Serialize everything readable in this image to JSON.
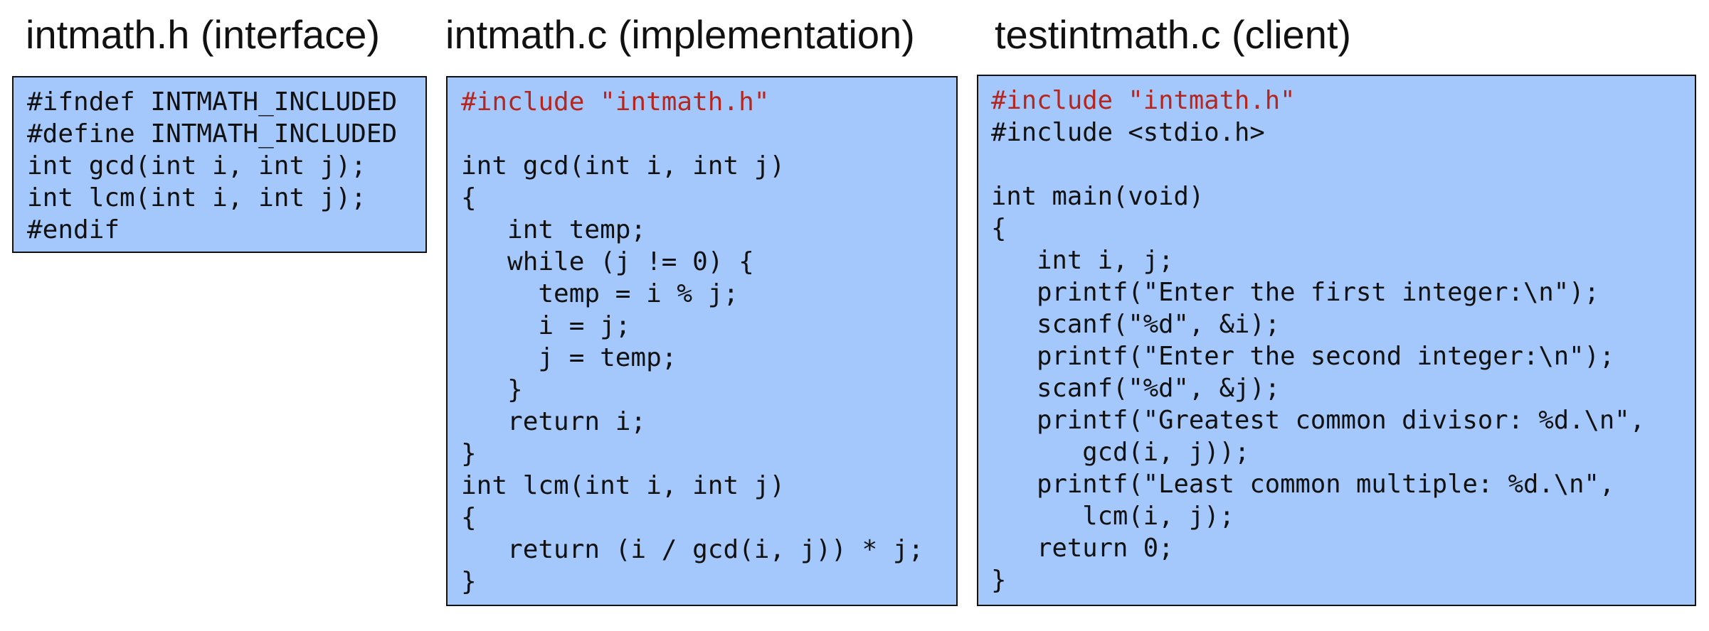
{
  "panels": {
    "header": {
      "title": "intmath.h (interface)",
      "lines": [
        {
          "text": "#ifndef INTMATH_INCLUDED",
          "kind": "code"
        },
        {
          "text": "#define INTMATH_INCLUDED",
          "kind": "code"
        },
        {
          "text": "int gcd(int i, int j);",
          "kind": "code"
        },
        {
          "text": "int lcm(int i, int j);",
          "kind": "code"
        },
        {
          "text": "#endif",
          "kind": "code"
        }
      ]
    },
    "impl": {
      "title": "intmath.c (implementation)",
      "lines": [
        {
          "text": "#include \"intmath.h\"",
          "kind": "include"
        },
        {
          "text": "",
          "kind": "code"
        },
        {
          "text": "int gcd(int i, int j)",
          "kind": "code"
        },
        {
          "text": "{",
          "kind": "code"
        },
        {
          "text": "   int temp;",
          "kind": "code"
        },
        {
          "text": "   while (j != 0) {",
          "kind": "code"
        },
        {
          "text": "     temp = i % j;",
          "kind": "code"
        },
        {
          "text": "     i = j;",
          "kind": "code"
        },
        {
          "text": "     j = temp;",
          "kind": "code"
        },
        {
          "text": "   }",
          "kind": "code"
        },
        {
          "text": "   return i;",
          "kind": "code"
        },
        {
          "text": "}",
          "kind": "code"
        },
        {
          "text": "int lcm(int i, int j)",
          "kind": "code"
        },
        {
          "text": "{",
          "kind": "code"
        },
        {
          "text": "   return (i / gcd(i, j)) * j;",
          "kind": "code"
        },
        {
          "text": "}",
          "kind": "code"
        }
      ]
    },
    "client": {
      "title": "testintmath.c (client)",
      "lines": [
        {
          "text": "#include \"intmath.h\"",
          "kind": "include"
        },
        {
          "text": "#include <stdio.h>",
          "kind": "code"
        },
        {
          "text": "",
          "kind": "code"
        },
        {
          "text": "int main(void)",
          "kind": "code"
        },
        {
          "text": "{",
          "kind": "code"
        },
        {
          "text": "   int i, j;",
          "kind": "code"
        },
        {
          "text": "   printf(\"Enter the first integer:\\n\");",
          "kind": "code"
        },
        {
          "text": "   scanf(\"%d\", &i);",
          "kind": "code"
        },
        {
          "text": "   printf(\"Enter the second integer:\\n\");",
          "kind": "code"
        },
        {
          "text": "   scanf(\"%d\", &j);",
          "kind": "code"
        },
        {
          "text": "   printf(\"Greatest common divisor: %d.\\n\",",
          "kind": "code"
        },
        {
          "text": "      gcd(i, j));",
          "kind": "code"
        },
        {
          "text": "   printf(\"Least common multiple: %d.\\n\",",
          "kind": "code"
        },
        {
          "text": "      lcm(i, j);",
          "kind": "code"
        },
        {
          "text": "   return 0;",
          "kind": "code"
        },
        {
          "text": "}",
          "kind": "code"
        }
      ]
    }
  },
  "colors": {
    "box_background": "#a4c8fb",
    "border": "#111111",
    "text": "#111111",
    "include_directive": "#b5261e"
  }
}
